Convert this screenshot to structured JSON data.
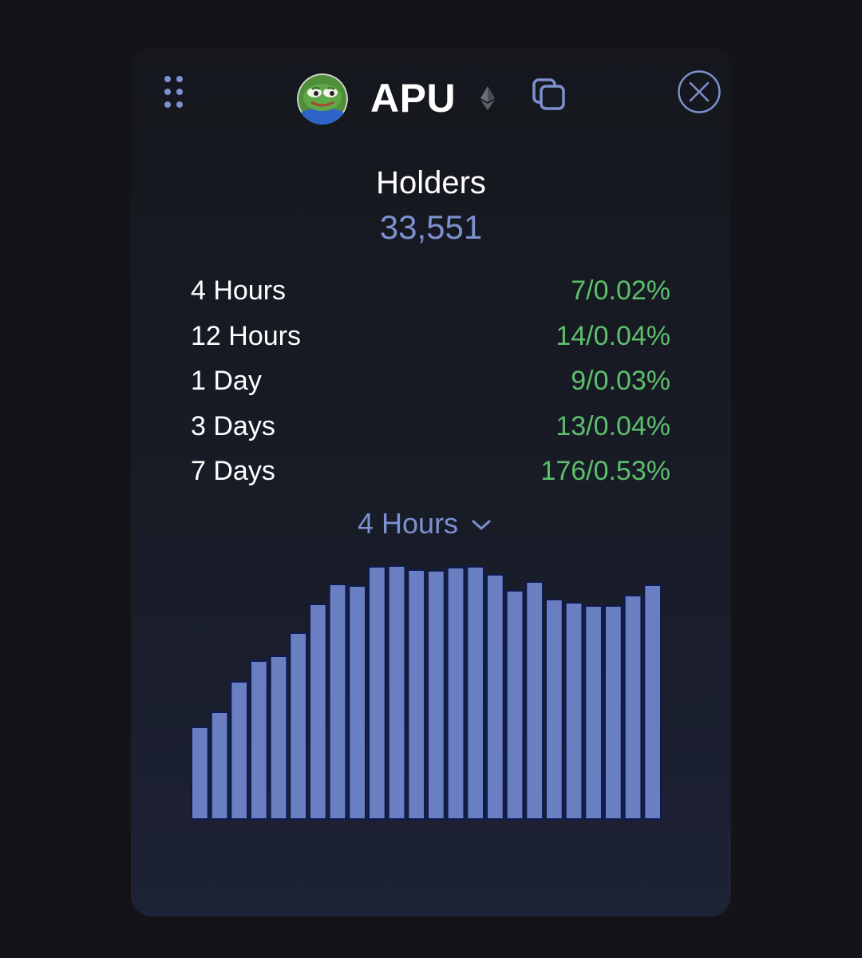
{
  "header": {
    "token_name": "APU",
    "drag_handle_icon": "grip-dots-icon",
    "avatar_icon": "pepe-frog-avatar",
    "chain_icon": "ethereum-icon",
    "copy_icon": "copy-icon",
    "close_icon": "close-circle-icon"
  },
  "holders": {
    "title": "Holders",
    "count": "33,551"
  },
  "stats": [
    {
      "label": "4 Hours",
      "value": "7/0.02%"
    },
    {
      "label": "12 Hours",
      "value": "14/0.04%"
    },
    {
      "label": "1 Day",
      "value": "9/0.03%"
    },
    {
      "label": "3 Days",
      "value": "13/0.04%"
    },
    {
      "label": "7 Days",
      "value": "176/0.53%"
    }
  ],
  "interval_selector": {
    "selected": "4 Hours",
    "icon": "chevron-down-icon"
  },
  "colors": {
    "accent": "#7d90cf",
    "positive": "#5cbf6b",
    "bar_fill": "#6a7fc2",
    "bar_stroke": "#0e1a4f"
  },
  "chart_data": {
    "type": "bar",
    "values": [
      115,
      134,
      172,
      198,
      204,
      233,
      269,
      294,
      292,
      316,
      317,
      312,
      311,
      315,
      316,
      306,
      286,
      297,
      275,
      271,
      267,
      267,
      280,
      293
    ],
    "ylim": [
      0,
      336
    ]
  }
}
